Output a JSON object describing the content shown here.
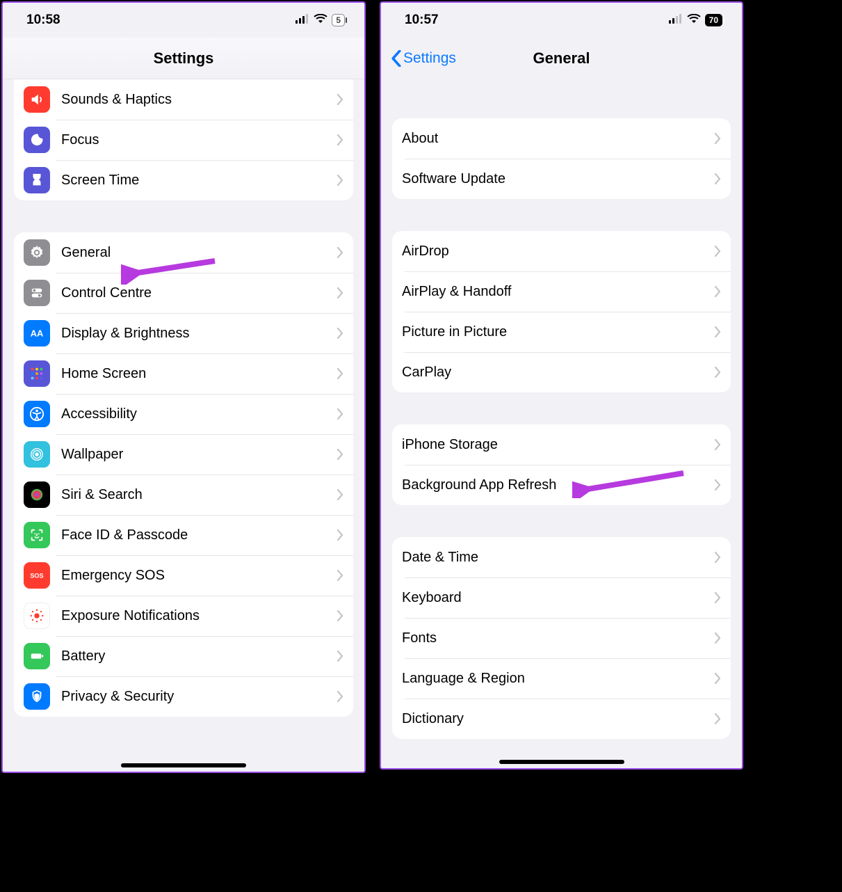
{
  "left": {
    "status": {
      "time": "10:58",
      "battery": "5"
    },
    "title": "Settings",
    "group1": [
      {
        "label": "Sounds & Haptics",
        "icon": "sounds-icon",
        "bg": "bg-red"
      },
      {
        "label": "Focus",
        "icon": "focus-icon",
        "bg": "bg-indigo"
      },
      {
        "label": "Screen Time",
        "icon": "screentime-icon",
        "bg": "bg-indigo"
      }
    ],
    "group2": [
      {
        "label": "General",
        "icon": "gear-icon",
        "bg": "bg-gray"
      },
      {
        "label": "Control Centre",
        "icon": "controlcentre-icon",
        "bg": "bg-gray"
      },
      {
        "label": "Display & Brightness",
        "icon": "display-icon",
        "bg": "bg-blue"
      },
      {
        "label": "Home Screen",
        "icon": "homescreen-icon",
        "bg": "bg-indigo"
      },
      {
        "label": "Accessibility",
        "icon": "accessibility-icon",
        "bg": "bg-blue"
      },
      {
        "label": "Wallpaper",
        "icon": "wallpaper-icon",
        "bg": "bg-cyan"
      },
      {
        "label": "Siri & Search",
        "icon": "siri-icon",
        "bg": "bg-black"
      },
      {
        "label": "Face ID & Passcode",
        "icon": "faceid-icon",
        "bg": "bg-green"
      },
      {
        "label": "Emergency SOS",
        "icon": "sos-icon",
        "bg": "bg-red"
      },
      {
        "label": "Exposure Notifications",
        "icon": "exposure-icon",
        "bg": "bg-white"
      },
      {
        "label": "Battery",
        "icon": "battery-icon",
        "bg": "bg-green"
      },
      {
        "label": "Privacy & Security",
        "icon": "privacy-icon",
        "bg": "bg-blue"
      }
    ]
  },
  "right": {
    "status": {
      "time": "10:57",
      "battery": "70"
    },
    "back": "Settings",
    "title": "General",
    "group1": [
      {
        "label": "About"
      },
      {
        "label": "Software Update"
      }
    ],
    "group2": [
      {
        "label": "AirDrop"
      },
      {
        "label": "AirPlay & Handoff"
      },
      {
        "label": "Picture in Picture"
      },
      {
        "label": "CarPlay"
      }
    ],
    "group3": [
      {
        "label": "iPhone Storage"
      },
      {
        "label": "Background App Refresh"
      }
    ],
    "group4": [
      {
        "label": "Date & Time"
      },
      {
        "label": "Keyboard"
      },
      {
        "label": "Fonts"
      },
      {
        "label": "Language & Region"
      },
      {
        "label": "Dictionary"
      }
    ]
  },
  "annotations": {
    "arrowColor": "#b63adf"
  }
}
